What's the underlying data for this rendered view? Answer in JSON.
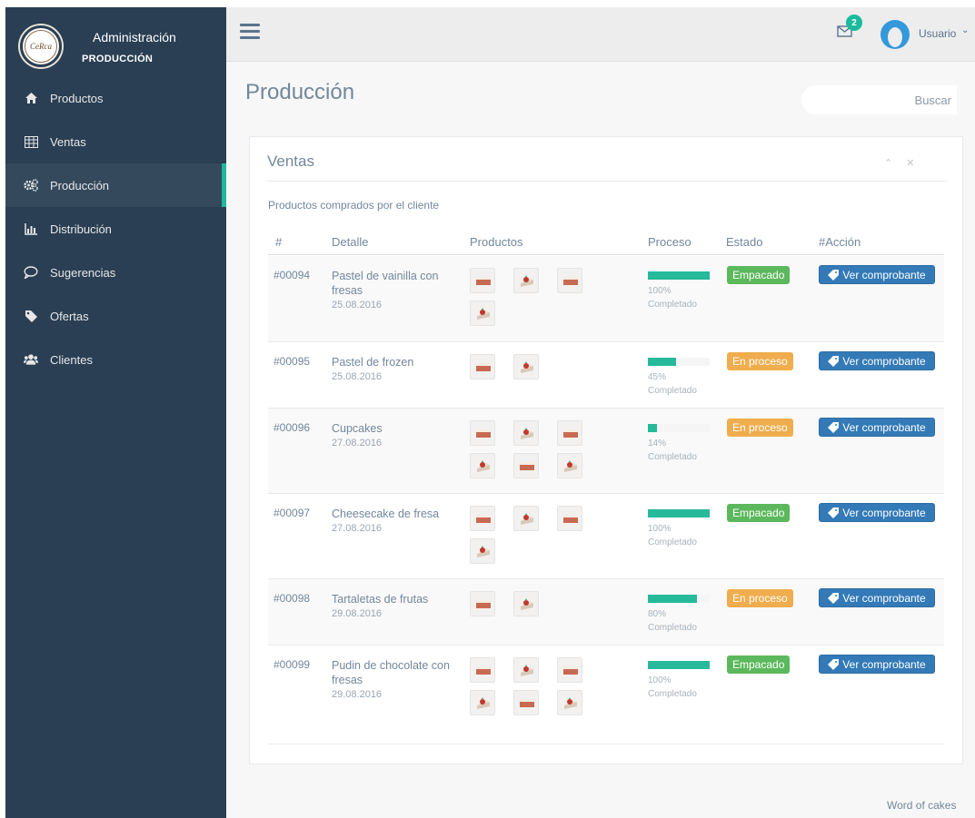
{
  "sidebar": {
    "brand_title": "Administración",
    "brand_subtitle": "PRODUCCIÓN",
    "logo_text": "CeRca",
    "items": [
      {
        "label": "Productos",
        "icon": "home-icon"
      },
      {
        "label": "Ventas",
        "icon": "table-icon"
      },
      {
        "label": "Producción",
        "icon": "gears-icon",
        "active": true
      },
      {
        "label": "Distribución",
        "icon": "bar-chart-icon"
      },
      {
        "label": "Sugerencias",
        "icon": "comment-icon"
      },
      {
        "label": "Ofertas",
        "icon": "tag-icon"
      },
      {
        "label": "Clientes",
        "icon": "users-icon"
      }
    ]
  },
  "topbar": {
    "mail_badge": "2",
    "user_name": "Usuario",
    "user_caret": "⌄"
  },
  "page": {
    "title": "Producción",
    "search_placeholder": "",
    "search_button": "Buscar"
  },
  "panel": {
    "title": "Ventas",
    "tools": "⌃ ✕",
    "description": "Productos comprados por el cliente",
    "headers": [
      "#",
      "Detalle",
      "Productos",
      "Proceso",
      "Estado",
      "#Acción"
    ],
    "action_label": "Ver comprobante",
    "rows": [
      {
        "id": "#00094",
        "name": "Pastel de vainilla con fresas",
        "date": "25.08.2016",
        "progress": 100,
        "progress_label": "100%",
        "progress_sub": "Completado",
        "status": "Empacado",
        "status_kind": "ok",
        "thumbs": [
          "cake-slice",
          "strawberry-cake",
          "cake-slice",
          "strawberry-cake"
        ]
      },
      {
        "id": "#00095",
        "name": "Pastel de frozen",
        "date": "25.08.2016",
        "progress": 45,
        "progress_label": "45%",
        "progress_sub": "Completado",
        "status": "En proceso",
        "status_kind": "wip",
        "thumbs": [
          "cake-slice",
          "strawberry-cake"
        ]
      },
      {
        "id": "#00096",
        "name": "Cupcakes",
        "date": "27.08.2016",
        "progress": 14,
        "progress_label": "14%",
        "progress_sub": "Completado",
        "status": "En proceso",
        "status_kind": "wip",
        "thumbs": [
          "cake-slice",
          "strawberry-cake",
          "cake-slice",
          "strawberry-cake",
          "cake-slice",
          "strawberry-cake"
        ]
      },
      {
        "id": "#00097",
        "name": "Cheesecake de fresa",
        "date": "27.08.2016",
        "progress": 100,
        "progress_label": "100%",
        "progress_sub": "Completado",
        "status": "Empacado",
        "status_kind": "ok",
        "thumbs": [
          "cake-slice",
          "strawberry-cake",
          "cake-slice",
          "strawberry-cake"
        ]
      },
      {
        "id": "#00098",
        "name": "Tartaletas de frutas",
        "date": "29.08.2016",
        "progress": 80,
        "progress_label": "80%",
        "progress_sub": "Completado",
        "status": "En proceso",
        "status_kind": "wip",
        "thumbs": [
          "cake-slice",
          "strawberry-cake"
        ]
      },
      {
        "id": "#00099",
        "name": "Pudin de chocolate con fresas",
        "date": "29.08.2016",
        "progress": 100,
        "progress_label": "100%",
        "progress_sub": "Completado",
        "status": "Empacado",
        "status_kind": "ok",
        "thumbs": [
          "cake-slice",
          "strawberry-cake",
          "cake-slice",
          "strawberry-cake",
          "cake-slice",
          "strawberry-cake"
        ]
      }
    ]
  },
  "footer": {
    "text": "Word of cakes"
  },
  "colors": {
    "sidebar": "#2a3f54",
    "accent": "#1abb9c",
    "progress": "#26b99a",
    "status_ok": "#5cb85c",
    "status_wip": "#f0ad4e",
    "button_primary": "#337ab7"
  }
}
